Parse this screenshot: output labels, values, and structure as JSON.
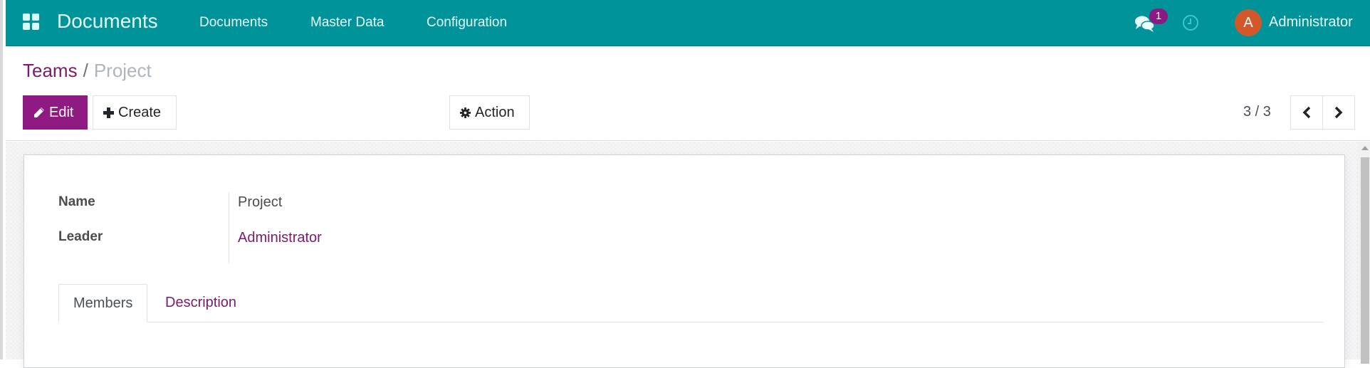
{
  "navbar": {
    "app_name": "Documents",
    "menu": [
      "Documents",
      "Master Data",
      "Configuration"
    ],
    "messages_badge": "1",
    "user_initial": "A",
    "user_name": "Administrator",
    "icons": {
      "apps": "apps-grid-icon",
      "messages": "chat-bubbles-icon",
      "activities": "clock-icon"
    }
  },
  "breadcrumb": {
    "parent": "Teams",
    "separator": "/",
    "current": "Project"
  },
  "toolbar": {
    "edit_label": "Edit",
    "create_label": "Create",
    "action_label": "Action",
    "pager": "3 / 3"
  },
  "form": {
    "fields": [
      {
        "label": "Name",
        "value": "Project"
      },
      {
        "label": "Leader",
        "value": "Administrator"
      }
    ],
    "tabs": [
      {
        "label": "Members",
        "active": true
      },
      {
        "label": "Description",
        "active": false
      }
    ]
  },
  "colors": {
    "navbar": "#00939a",
    "primary": "#8f1a82",
    "link": "#7c1a6e",
    "avatar": "#d2582c"
  }
}
